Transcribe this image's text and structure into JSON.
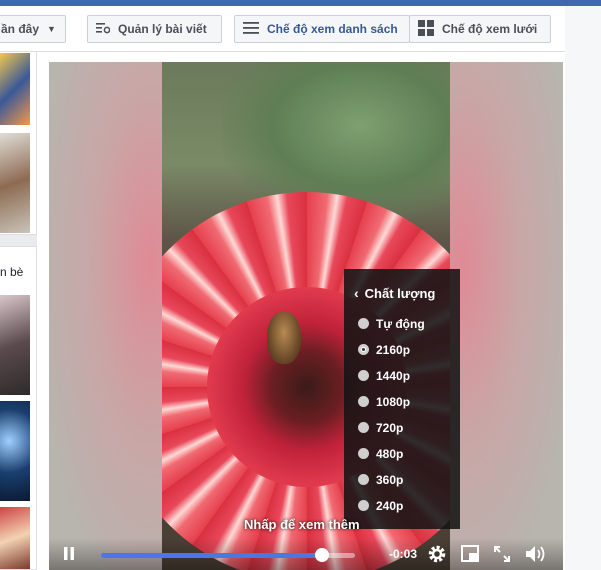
{
  "toolbar": {
    "sort_label": "ần đây",
    "manage_label": "Quản lý bài viết",
    "list_view_label": "Chế độ xem danh sách",
    "grid_view_label": "Chế độ xem lưới"
  },
  "sidebar": {
    "friends_label": "n bè"
  },
  "video": {
    "hint": "Nhấp để xem thêm",
    "time": "-0:03",
    "progress": 0.87,
    "quality_menu": {
      "title": "Chất lượng",
      "selected": "2160p",
      "options": [
        "Tự động",
        "2160p",
        "1440p",
        "1080p",
        "720p",
        "480p",
        "360p",
        "240p"
      ]
    }
  },
  "icons": {
    "manage": "manage-posts-icon",
    "list": "list-icon",
    "grid": "grid-icon",
    "play": "pause-icon",
    "settings": "gear-icon",
    "pip": "picture-in-picture-icon",
    "fullscreen": "fullscreen-icon",
    "volume": "volume-icon"
  },
  "colors": {
    "brand": "#4267b2",
    "progress": "#4a76e8"
  }
}
